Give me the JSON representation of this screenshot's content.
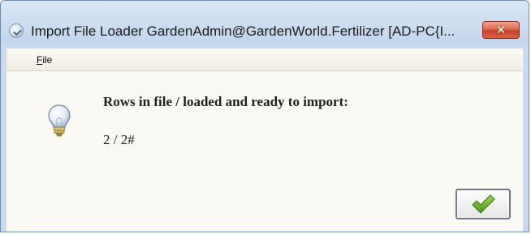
{
  "window": {
    "title": "Import File Loader  GardenAdmin@GardenWorld.Fertilizer [AD-PC{I...",
    "close_glyph": "✕"
  },
  "menu": {
    "file_mnemonic": "F",
    "file_rest": "ile"
  },
  "message": {
    "heading": "Rows in file / loaded and ready to import:",
    "value": "2 / 2#"
  },
  "icons": {
    "app": "app-globe-icon",
    "info": "lightbulb-icon",
    "ok": "checkmark-icon"
  },
  "colors": {
    "close_button": "#c8412a",
    "check": "#5aa41e",
    "content_bg": "#fbf9f3"
  }
}
